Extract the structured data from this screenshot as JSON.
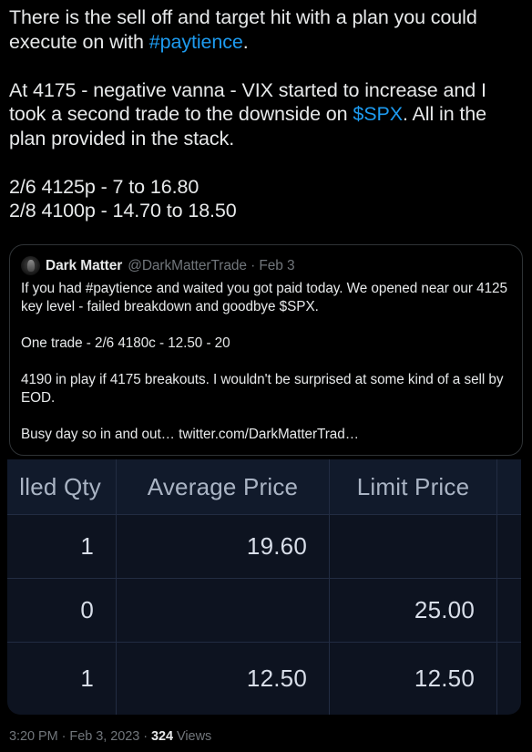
{
  "theme": {
    "background": "#000000",
    "text": "#e7e9ea",
    "muted": "#71767b",
    "link": "#1d9bf0",
    "border": "#2f3336",
    "table_bg": "#0d1320",
    "table_header_bg": "#111a2b",
    "table_grid": "#222c42"
  },
  "tweet": {
    "paragraphs": [
      {
        "runs": [
          {
            "text": "There is the sell off and target hit with a plan you could execute on with ",
            "type": "text"
          },
          {
            "text": "#paytience",
            "type": "link"
          },
          {
            "text": ".",
            "type": "text"
          }
        ]
      },
      {
        "blank": true
      },
      {
        "runs": [
          {
            "text": "At 4175 - negative vanna - VIX started to increase and I took a second trade to the downside on ",
            "type": "text"
          },
          {
            "text": "$SPX",
            "type": "link"
          },
          {
            "text": ". All in the plan provided in the stack.",
            "type": "text"
          }
        ]
      },
      {
        "blank": true
      },
      {
        "runs": [
          {
            "text": "2/6 4125p - 7 to 16.80",
            "type": "text"
          }
        ]
      },
      {
        "runs": [
          {
            "text": "2/8 4100p - 14.70 to 18.50",
            "type": "text"
          }
        ]
      }
    ],
    "line1a": "There is the sell off and target hit with a plan you could execute on with ",
    "hashtag": "#paytience",
    "line1b": ".",
    "line2a": "At 4175 - negative vanna - VIX started to increase and I took a second trade to the downside on ",
    "cashtag": "$SPX",
    "line2b": ". All in the plan provided in the stack.",
    "line3": "2/6 4125p - 7 to 16.80",
    "line4": "2/8 4100p - 14.70 to 18.50"
  },
  "quoted_tweet": {
    "avatar_icon": "avatar-image",
    "display_name": "Dark Matter",
    "handle_and_date": "@DarkMatterTrade · Feb 3",
    "handle": "@DarkMatterTrade",
    "date": "Feb 3",
    "paragraphs": [
      "If you had #paytience and waited you got paid today. We opened near our 4125 key level - failed breakdown and goodbye $SPX.",
      "One trade - 2/6 4180c - 12.50 - 20",
      "4190 in play if 4175 breakouts. I wouldn't be surprised at some kind of a sell by EOD.",
      "Busy day so in and out…  twitter.com/DarkMatterTrad…"
    ],
    "p1": "If you had #paytience and waited you got paid today. We opened near our 4125 key level - failed breakdown and goodbye $SPX.",
    "p2": "One trade - 2/6 4180c - 12.50 - 20",
    "p3": "4190 in play if 4175 breakouts. I wouldn't be surprised at some kind of a sell by EOD.",
    "p4": "Busy day so in and out…  twitter.com/DarkMatterTrad…"
  },
  "order_table": {
    "note": "cropped broker order-table screenshot attached to the tweet",
    "headers": [
      "lled Qty",
      "Average Price",
      "Limit Price",
      ""
    ],
    "h0": "lled Qty",
    "h1": "Average Price",
    "h2": "Limit Price",
    "h3": "",
    "rows": [
      {
        "filled_qty": "1",
        "average_price": "19.60",
        "limit_price": "",
        "extra": ""
      },
      {
        "filled_qty": "0",
        "average_price": "",
        "limit_price": "25.00",
        "extra": ""
      },
      {
        "filled_qty": "1",
        "average_price": "12.50",
        "limit_price": "12.50",
        "extra": ""
      }
    ],
    "r0c0": "1",
    "r0c1": "19.60",
    "r0c2": "",
    "r0c3": "",
    "r1c0": "0",
    "r1c1": "",
    "r1c2": "25.00",
    "r1c3": "",
    "r2c0": "1",
    "r2c1": "12.50",
    "r2c2": "12.50",
    "r2c3": ""
  },
  "footer": {
    "time": "3:20 PM",
    "sep1": " · ",
    "date": "Feb 3, 2023",
    "sep2": " · ",
    "views_count": "324",
    "views_label": " Views"
  }
}
